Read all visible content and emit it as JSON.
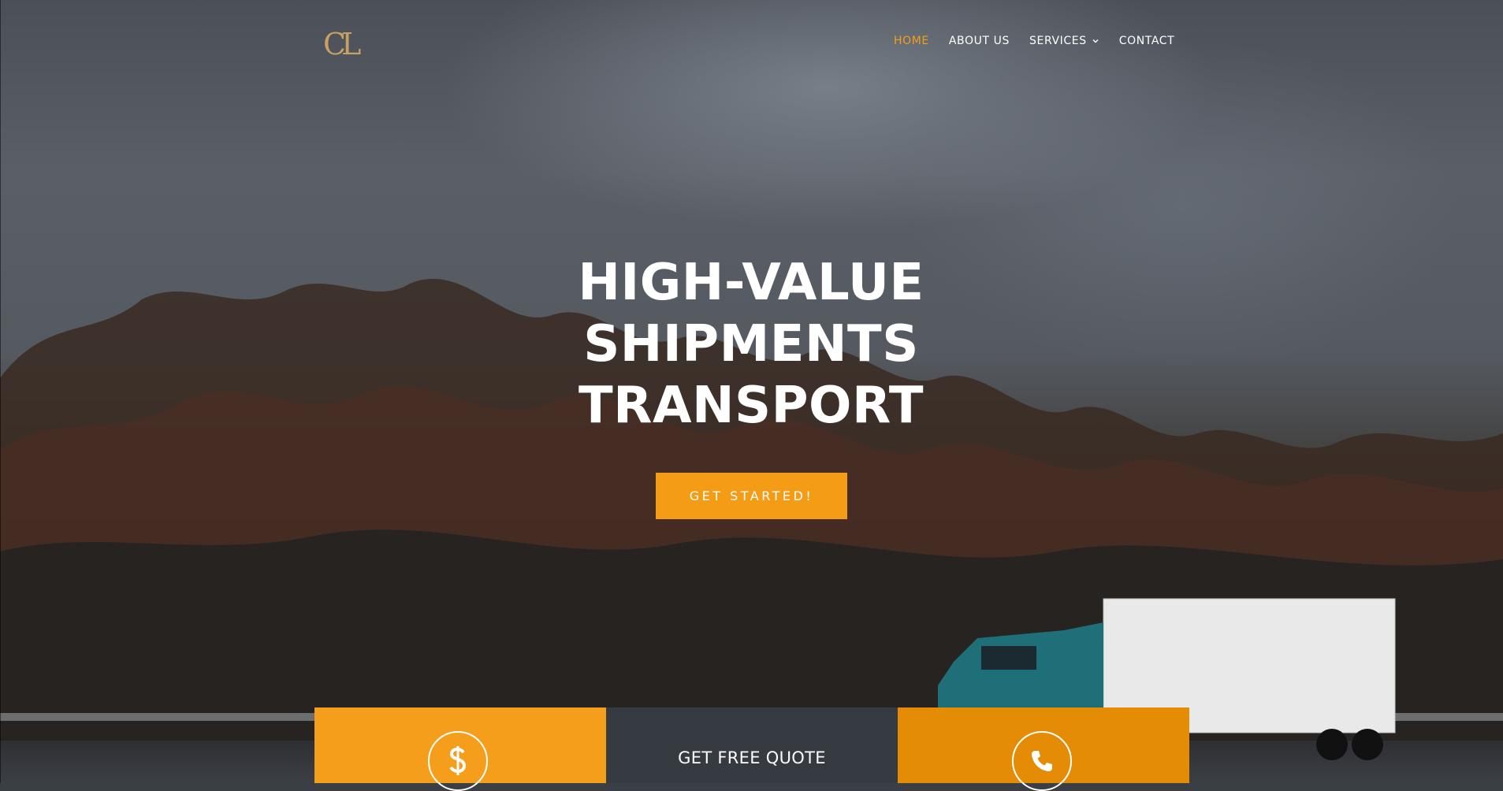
{
  "header": {
    "logo_letters": "CL",
    "nav": [
      {
        "label": "HOME",
        "active": true
      },
      {
        "label": "ABOUT US",
        "active": false
      },
      {
        "label": "SERVICES",
        "active": false,
        "has_dropdown": true
      },
      {
        "label": "CONTACT",
        "active": false
      }
    ]
  },
  "hero": {
    "headline_lines": [
      "HIGH-VALUE",
      "SHIPMENTS",
      "TRANSPORT"
    ],
    "cta_label": "GET STARTED!"
  },
  "feature_boxes": {
    "box1_icon": "dollar-icon",
    "box2_label": "GET FREE QUOTE",
    "box3_icon": "phone-icon"
  },
  "colors": {
    "accent": "#f59e1b",
    "accent_dark": "#e48c06",
    "dark_panel": "#363a41",
    "logo_gold": "#c9a063"
  }
}
